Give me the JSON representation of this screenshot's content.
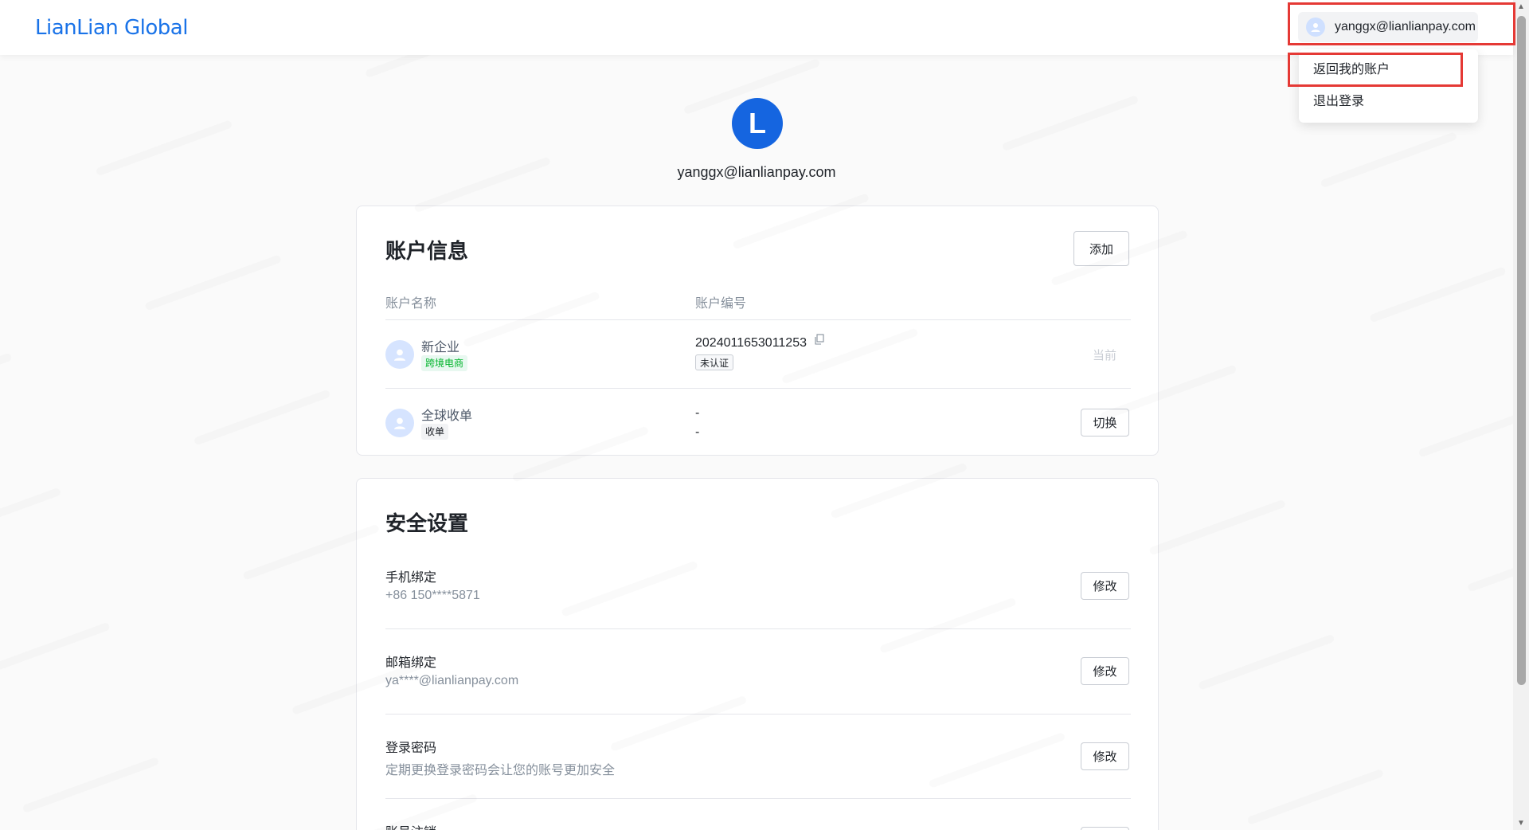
{
  "header": {
    "logo_text": "LianLian Global",
    "user_email": "yanggx@lianlianpay.com"
  },
  "dropdown": {
    "items": [
      {
        "label": "返回我的账户"
      },
      {
        "label": "退出登录"
      }
    ]
  },
  "profile": {
    "avatar_letter": "L",
    "email": "yanggx@lianlianpay.com"
  },
  "account_info": {
    "title": "账户信息",
    "add_label": "添加",
    "columns": [
      "账户名称",
      "账户编号"
    ],
    "rows": [
      {
        "name": "新企业",
        "tag": "跨境电商",
        "number": "2024011653011253",
        "status_tag": "未认证",
        "action": "当前"
      },
      {
        "name": "全球收单",
        "tag": "收单",
        "number": "-",
        "number2": "-",
        "action": "切换"
      }
    ]
  },
  "security": {
    "title": "安全设置",
    "items": [
      {
        "label": "手机绑定",
        "value": "+86 150****5871",
        "action": "修改"
      },
      {
        "label": "邮箱绑定",
        "value": "ya****@lianlianpay.com",
        "action": "修改"
      },
      {
        "label": "登录密码",
        "value": "定期更换登录密码会让您的账号更加安全",
        "action": "修改"
      },
      {
        "label": "账号注销"
      }
    ]
  },
  "colors": {
    "brand": "#1a73e8",
    "avatar": "#1565e0",
    "highlight": "#e53935"
  }
}
